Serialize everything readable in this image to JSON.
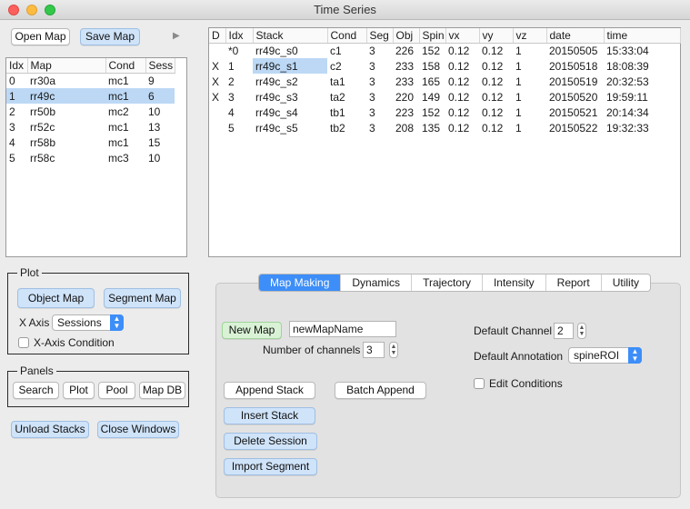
{
  "window": {
    "title": "Time Series"
  },
  "toolbar": {
    "open_map": "Open Map",
    "save_map": "Save Map",
    "play_icon": "play-icon"
  },
  "maps_table": {
    "headers": [
      "Idx",
      "Map",
      "Cond",
      "Sess"
    ],
    "rows": [
      [
        "0",
        "rr30a",
        "mc1",
        "9"
      ],
      [
        "1",
        "rr49c",
        "mc1",
        "6"
      ],
      [
        "2",
        "rr50b",
        "mc2",
        "10"
      ],
      [
        "3",
        "rr52c",
        "mc1",
        "13"
      ],
      [
        "4",
        "rr58b",
        "mc1",
        "15"
      ],
      [
        "5",
        "rr58c",
        "mc3",
        "10"
      ]
    ],
    "selected_index": 1
  },
  "stacks_table": {
    "headers": [
      "D",
      "Idx",
      "Stack",
      "Cond",
      "Seg",
      "Obj",
      "Spin",
      "vx",
      "vy",
      "vz",
      "date",
      "time"
    ],
    "rows": [
      [
        "",
        "*0",
        "rr49c_s0",
        "c1",
        "3",
        "226",
        "152",
        "0.12",
        "0.12",
        "1",
        "20150505",
        "15:33:04"
      ],
      [
        "X",
        "1",
        "rr49c_s1",
        "c2",
        "3",
        "233",
        "158",
        "0.12",
        "0.12",
        "1",
        "20150518",
        "18:08:39"
      ],
      [
        "X",
        "2",
        "rr49c_s2",
        "ta1",
        "3",
        "233",
        "165",
        "0.12",
        "0.12",
        "1",
        "20150519",
        "20:32:53"
      ],
      [
        "X",
        "3",
        "rr49c_s3",
        "ta2",
        "3",
        "220",
        "149",
        "0.12",
        "0.12",
        "1",
        "20150520",
        "19:59:11"
      ],
      [
        "",
        "4",
        "rr49c_s4",
        "tb1",
        "3",
        "223",
        "152",
        "0.12",
        "0.12",
        "1",
        "20150521",
        "20:14:34"
      ],
      [
        "",
        "5",
        "rr49c_s5",
        "tb2",
        "3",
        "208",
        "135",
        "0.12",
        "0.12",
        "1",
        "20150522",
        "19:32:33"
      ]
    ]
  },
  "plot": {
    "title": "Plot",
    "object_map": "Object Map",
    "segment_map": "Segment Map",
    "x_axis_label": "X Axis",
    "x_axis_value": "Sessions",
    "x_axis_condition": "X-Axis Condition"
  },
  "panels": {
    "title": "Panels",
    "search": "Search",
    "plot": "Plot",
    "pool": "Pool",
    "map_db": "Map DB"
  },
  "bottom": {
    "unload_stacks": "Unload Stacks",
    "close_windows": "Close Windows"
  },
  "tabs": [
    "Map Making",
    "Dynamics",
    "Trajectory",
    "Intensity",
    "Report",
    "Utility"
  ],
  "map_making": {
    "new_map": "New Map",
    "new_map_name": "newMapName",
    "num_channels_label": "Number of channels",
    "num_channels_value": "3",
    "default_channel_label": "Default Channel",
    "default_channel_value": "2",
    "default_annotation_label": "Default Annotation",
    "default_annotation_value": "spineROI",
    "edit_conditions": "Edit Conditions",
    "append_stack": "Append Stack",
    "batch_append": "Batch Append",
    "insert_stack": "Insert Stack",
    "delete_session": "Delete Session",
    "import_segment": "Import Segment"
  },
  "colors": {
    "accent": "#3d8ef8",
    "selection": "#bcd8f5",
    "green_button": "#d9f2d6"
  }
}
